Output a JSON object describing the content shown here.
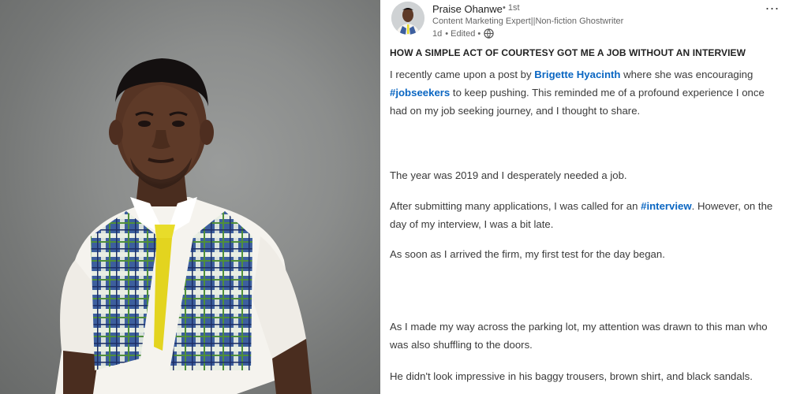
{
  "post": {
    "author": {
      "name": "Praise Ohanwe",
      "degree": "• 1st",
      "headline": "Content Marketing Expert||Non-fiction Ghostwriter",
      "time": "1d",
      "edited": "• Edited •",
      "visibility_icon": "globe-icon"
    },
    "menu_icon": "more-icon",
    "more_label": "...",
    "title": "HOW A SIMPLE ACT OF COURTESY GOT ME A JOB WITHOUT AN INTERVIEW",
    "p1": {
      "t1": "I recently came upon a post by ",
      "mention": "Brigette Hyacinth",
      "t2": " where she was encouraging ",
      "hashtag": "#jobseekers",
      "t3": " to keep pushing. This reminded me of a profound experience I once had on my job seeking journey, and I thought to share."
    },
    "p2": "The year was 2019 and I desperately needed a job.",
    "p3": {
      "t1": "After submitting many applications, I was called for an ",
      "hashtag": "#interview",
      "t2": ". However, on the day of my interview, I was a bit late."
    },
    "p4": "As soon as I arrived the firm, my first test for the day began.",
    "p5": "As I made my way across the parking lot, my attention was drawn to this man who was also shuffling to the doors.",
    "p6": "He didn't look impressive in his baggy trousers, brown shirt, and black sandals."
  },
  "colors": {
    "link": "#0a66c2",
    "text": "#3a3a3a",
    "photo_background": "#8b8d8c",
    "tie": "#e8dc2a"
  }
}
